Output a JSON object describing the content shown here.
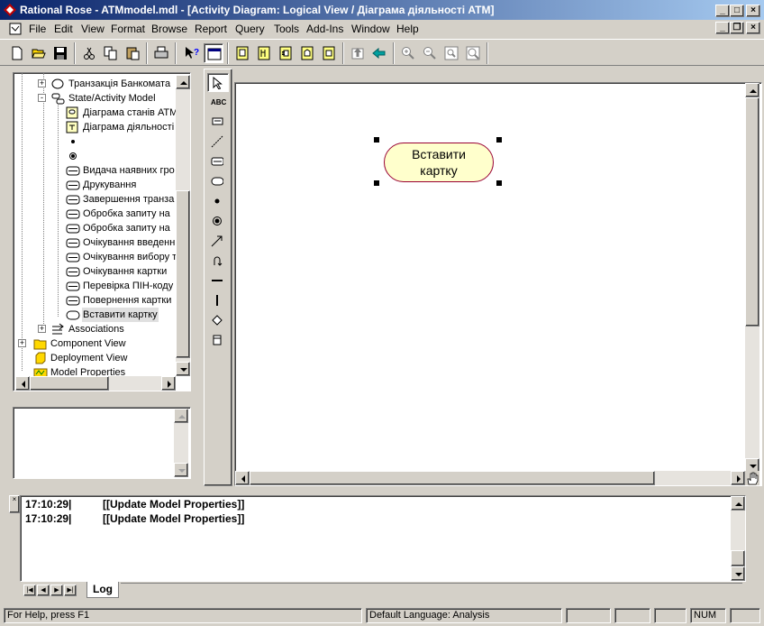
{
  "window": {
    "title": "Rational Rose - ATMmodel.mdl - [Activity Diagram: Logical View / Діаграма діяльності ATM]"
  },
  "menu": [
    "File",
    "Edit",
    "View",
    "Format",
    "Browse",
    "Report",
    "Query",
    "Tools",
    "Add-Ins",
    "Window",
    "Help"
  ],
  "toolbar": {
    "buttons": [
      "new-icon",
      "open-icon",
      "save-icon",
      "cut-icon",
      "copy-icon",
      "paste-icon",
      "print-icon",
      "context-help-icon",
      "view-doc-icon",
      "browse-class-diagram-icon",
      "browse-interaction-diagram-icon",
      "browse-component-diagram-icon",
      "browse-deployment-diagram-icon",
      "browse-parent-icon",
      "browse-previous-icon",
      "zoom-in-icon",
      "zoom-out-icon",
      "fit-in-window-icon",
      "undo-fit-icon"
    ]
  },
  "tree": {
    "items": [
      {
        "label": "Транзакція Банкомата",
        "icon": "use-case-icon",
        "expander": "+"
      },
      {
        "label": "State/Activity Model",
        "icon": "state-model-icon",
        "expander": "-"
      },
      {
        "label": "Діаграма станів АТМ",
        "icon": "statechart-diagram-icon",
        "expander": ""
      },
      {
        "label": "Діаграма діяльності",
        "icon": "activity-diagram-icon",
        "expander": ""
      },
      {
        "label": "",
        "icon": "start-state-icon",
        "expander": ""
      },
      {
        "label": "",
        "icon": "end-state-icon",
        "expander": ""
      },
      {
        "label": "Видача наявних гро",
        "icon": "state-icon",
        "expander": ""
      },
      {
        "label": "Друкування",
        "icon": "state-icon",
        "expander": ""
      },
      {
        "label": "Завершення транза",
        "icon": "state-icon",
        "expander": ""
      },
      {
        "label": "Обробка запиту на",
        "icon": "state-icon",
        "expander": ""
      },
      {
        "label": "Обробка запиту на",
        "icon": "state-icon",
        "expander": ""
      },
      {
        "label": "Очікування введенн",
        "icon": "state-icon",
        "expander": ""
      },
      {
        "label": "Очікування вибору т",
        "icon": "state-icon",
        "expander": ""
      },
      {
        "label": "Очікування картки",
        "icon": "state-icon",
        "expander": ""
      },
      {
        "label": "Перевірка ПІН-коду",
        "icon": "state-icon",
        "expander": ""
      },
      {
        "label": "Повернення картки",
        "icon": "state-icon",
        "expander": ""
      },
      {
        "label": "Вставити картку",
        "icon": "activity-icon",
        "expander": "",
        "selected": true
      },
      {
        "label": "Associations",
        "icon": "associations-icon",
        "expander": "+"
      },
      {
        "label": "Component View",
        "icon": "folder-icon",
        "expander": "+"
      },
      {
        "label": "Deployment View",
        "icon": "deployment-view-icon",
        "expander": ""
      },
      {
        "label": "Model Properties",
        "icon": "model-properties-icon",
        "expander": ""
      }
    ]
  },
  "toolbox": [
    "selection-arrow-icon",
    "text-box-icon",
    "note-icon",
    "anchor-note-icon",
    "state-icon",
    "activity-icon",
    "start-state-icon",
    "end-state-icon",
    "state-transition-icon",
    "transition-to-self-icon",
    "horizontal-sync-icon",
    "vertical-sync-icon",
    "decision-icon",
    "swimlane-icon"
  ],
  "diagram": {
    "activity_label": "Вставити\nкартку"
  },
  "log": {
    "lines": [
      {
        "time": "17:10:29|",
        "text": "[[Update Model Properties]]"
      },
      {
        "time": "17:10:29|",
        "text": "[[Update Model Properties]]"
      }
    ],
    "tab": "Log"
  },
  "status": {
    "help": "For Help, press F1",
    "language": "Default Language: Analysis",
    "num": "NUM"
  },
  "colors": {
    "activity_fill": "#ffffcc",
    "activity_border": "#990033",
    "titlebar_start": "#0a246a",
    "titlebar_end": "#a6caf0"
  }
}
